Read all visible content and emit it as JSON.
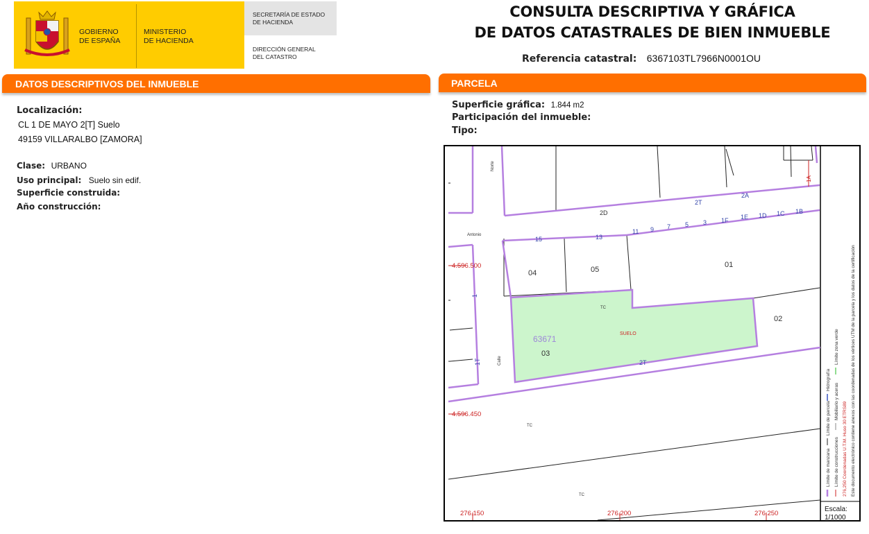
{
  "header": {
    "gov_line1": "GOBIERNO",
    "gov_line2": "DE ESPAÑA",
    "min_line1": "MINISTERIO",
    "min_line2": "DE HACIENDA",
    "sec_line1": "SECRETARÍA DE ESTADO",
    "sec_line2": "DE HACIENDA",
    "dg_line1": "DIRECCIÓN GENERAL",
    "dg_line2": "DEL CATASTRO",
    "title_line1": "CONSULTA DESCRIPTIVA Y GRÁFICA",
    "title_line2": "DE DATOS CATASTRALES DE BIEN INMUEBLE",
    "ref_label": "Referencia catastral:",
    "ref_value": "6367103TL7966N0001OU"
  },
  "left": {
    "bar_title": "DATOS DESCRIPTIVOS DEL INMUEBLE",
    "loc_label": "Localización:",
    "loc_line1": "CL 1 DE MAYO 2[T] Suelo",
    "loc_line2": "49159 VILLARALBO [ZAMORA]",
    "clase_label": "Clase:",
    "clase_value": "URBANO",
    "uso_label": "Uso principal:",
    "uso_value": "Suelo sin edif.",
    "sup_label": "Superficie construida:",
    "anio_label": "Año construcción:"
  },
  "right": {
    "bar_title": "PARCELA",
    "sup_label": "Superficie gráfica:",
    "sup_value": "1.844 m2",
    "part_label": "Participación del inmueble:",
    "tipo_label": "Tipo:"
  },
  "map": {
    "colors": {
      "parcel_fill": "#ccf5cc",
      "block_line": "#b57fe0",
      "coord_red": "#cc2222"
    },
    "coord_y1": "4.596.500",
    "coord_y2": "4.596.450",
    "coord_x1": "276.150",
    "coord_x2": "276.200",
    "coord_x3": "276.250",
    "parcel_ref": "63671",
    "parcel_suelo": "SUELO",
    "numbers": {
      "n04": "04",
      "n05": "05",
      "n01": "01",
      "n02": "02",
      "n03": "03",
      "n2d": "2D",
      "n2t_top": "2T",
      "n2a": "2A",
      "n15": "15",
      "n13": "13",
      "n11": "11",
      "n9": "9",
      "n7": "7",
      "n5": "5",
      "n3": "3",
      "n1f": "1F",
      "n1e": "1E",
      "n1d": "1D",
      "n1c": "1C",
      "n1b": "1B",
      "n2t_bot": "2T",
      "tc1": "TC",
      "tc2": "TC",
      "tc3": "TC",
      "n1a": "1A",
      "n1_left": "1",
      "n1t_left": "1T"
    },
    "street_norte": "Norte",
    "street_antonio": "Antonio",
    "street_calle": "Calle",
    "legend": {
      "manzana": "Límite de manzana",
      "construcciones": "Límite de construcciones",
      "parcela": "Límite de parcela",
      "mobiliario": "Mobiliario y aceras",
      "hidrografia": "Hidrografía",
      "zona_verde": "Límite zona verde",
      "coords_note": "276,250 Coordenadas U.T.M. Huso 30 ETRS89",
      "doc_note": "Este documento electrónico contiene anexos con las coordenadas de los vértices UTM de la parcela y los datos de la certificación"
    },
    "scale_label": "Escala:",
    "scale_value": "1/1000"
  }
}
